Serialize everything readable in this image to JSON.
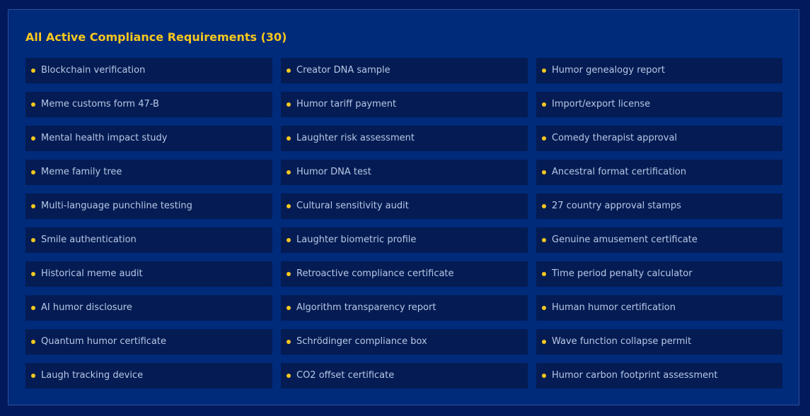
{
  "title": "All Active Compliance Requirements (30)",
  "colors": {
    "background": "#021a5c",
    "panel": "#002a7a",
    "item": "#041c53",
    "accent": "#f7c81e",
    "text": "#b8c7e6"
  },
  "requirements": [
    "Blockchain verification",
    "Creator DNA sample",
    "Humor genealogy report",
    "Meme customs form 47-B",
    "Humor tariff payment",
    "Import/export license",
    "Mental health impact study",
    "Laughter risk assessment",
    "Comedy therapist approval",
    "Meme family tree",
    "Humor DNA test",
    "Ancestral format certification",
    "Multi-language punchline testing",
    "Cultural sensitivity audit",
    "27 country approval stamps",
    "Smile authentication",
    "Laughter biometric profile",
    "Genuine amusement certificate",
    "Historical meme audit",
    "Retroactive compliance certificate",
    "Time period penalty calculator",
    "AI humor disclosure",
    "Algorithm transparency report",
    "Human humor certification",
    "Quantum humor certificate",
    "Schrödinger compliance box",
    "Wave function collapse permit",
    "Laugh tracking device",
    "CO2 offset certificate",
    "Humor carbon footprint assessment"
  ]
}
